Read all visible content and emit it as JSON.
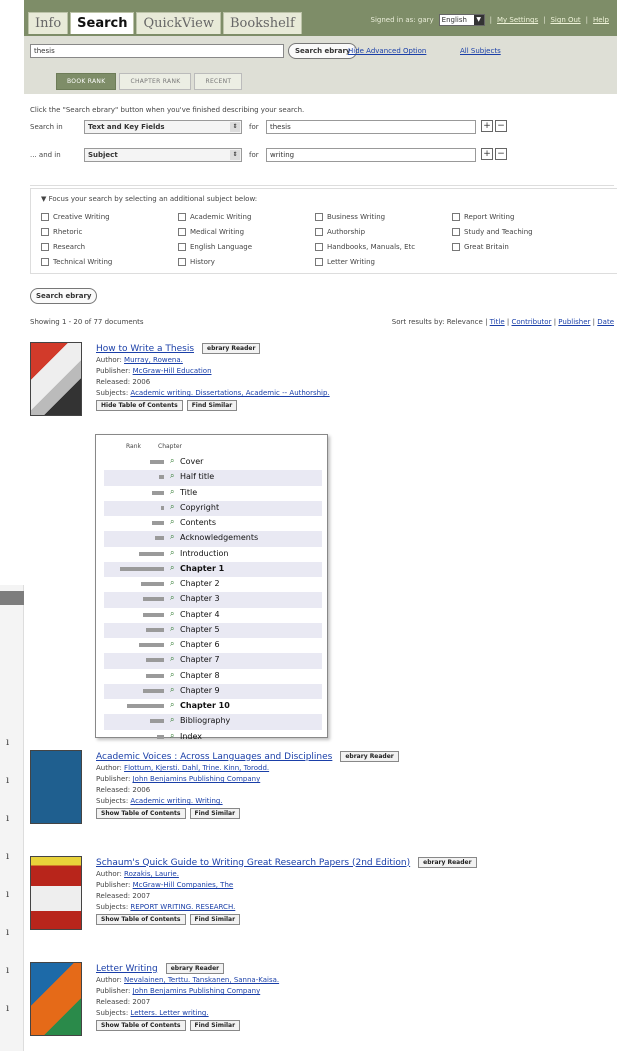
{
  "header": {
    "tabs": [
      "Info",
      "Search",
      "QuickView",
      "Bookshelf"
    ],
    "signed_in": "Signed in as: gary",
    "language": "English",
    "links": [
      "My Settings",
      "Sign Out",
      "Help"
    ],
    "colors": {
      "header_bg": "#7e8d68",
      "link": "#1a3fa8"
    }
  },
  "search": {
    "query": "thesis",
    "button": "Search ebrary",
    "hide_advanced": "Hide Advanced Option",
    "all_subjects": "All Subjects",
    "rank_tabs": [
      "BOOK RANK",
      "CHAPTER RANK",
      "RECENT"
    ]
  },
  "advanced": {
    "hint": "Click the \"Search ebrary\" button when you've finished describing your search.",
    "rows": [
      {
        "label": "Search in",
        "field": "Text and Key Fields",
        "for": "for",
        "value": "thesis"
      },
      {
        "label": "... and in",
        "field": "Subject",
        "for": "for",
        "value": "writing"
      }
    ],
    "focus_title": "Focus your search by selecting an additional subject below:",
    "subjects": [
      "Creative Writing",
      "Academic Writing",
      "Business Writing",
      "Report Writing",
      "Rhetoric",
      "Medical Writing",
      "Authorship",
      "Study and Teaching",
      "Research",
      "English Language",
      "Handbooks, Manuals, Etc",
      "Great Britain",
      "Technical Writing",
      "History",
      "Letter Writing"
    ],
    "search_button": "Search ebrary"
  },
  "results_info": {
    "showing": "Showing 1 - 20 of 77 documents",
    "sort_label": "Sort results by:",
    "sort_options": [
      "Relevance",
      "Title",
      "Contributor",
      "Publisher",
      "Date"
    ]
  },
  "results": [
    {
      "title": "How to Write a Thesis",
      "reader_btn": "ebrary Reader",
      "author_label": "Author:",
      "authors": "Murray, Rowena.",
      "publisher_label": "Publisher:",
      "publisher": "McGraw-Hill Education",
      "released": "Released: 2006",
      "subjects_label": "Subjects:",
      "subjects": "Academic writing.  Dissertations, Academic -- Authorship.",
      "toc_btn": "Hide Table of Contents",
      "similar_btn": "Find Similar"
    },
    {
      "title": "Academic Voices : Across Languages and Disciplines",
      "reader_btn": "ebrary Reader",
      "author_label": "Author:",
      "authors": "Flottum, Kjersti.  Dahl, Trine.  Kinn, Torodd.",
      "publisher_label": "Publisher:",
      "publisher": "John Benjamins Publishing Company",
      "released": "Released: 2006",
      "subjects_label": "Subjects:",
      "subjects": "Academic writing.  Writing.",
      "toc_btn": "Show Table of Contents",
      "similar_btn": "Find Similar"
    },
    {
      "title": "Schaum's Quick Guide to Writing Great Research Papers (2nd Edition)",
      "reader_btn": "ebrary Reader",
      "author_label": "Author:",
      "authors": "Rozakis, Laurie.",
      "publisher_label": "Publisher:",
      "publisher": "McGraw-Hill Companies, The",
      "released": "Released: 2007",
      "subjects_label": "Subjects:",
      "subjects": "REPORT WRITING.  RESEARCH.",
      "toc_btn": "Show Table of Contents",
      "similar_btn": "Find Similar"
    },
    {
      "title": "Letter Writing",
      "reader_btn": "ebrary Reader",
      "author_label": "Author:",
      "authors": "Nevalainen, Terttu.  Tanskanen, Sanna-Kaisa.",
      "publisher_label": "Publisher:",
      "publisher": "John Benjamins Publishing Company",
      "released": "Released: 2007",
      "subjects_label": "Subjects:",
      "subjects": "Letters.  Letter writing.",
      "toc_btn": "Show Table of Contents",
      "similar_btn": "Find Similar"
    }
  ],
  "toc": {
    "rank_header": "Rank",
    "chapter_header": "Chapter",
    "chapters": [
      {
        "name": "Cover",
        "rank": 0.3,
        "bold": false
      },
      {
        "name": "Half title",
        "rank": 0.1,
        "bold": false
      },
      {
        "name": "Title",
        "rank": 0.25,
        "bold": false
      },
      {
        "name": "Copyright",
        "rank": 0.05,
        "bold": false
      },
      {
        "name": "Contents",
        "rank": 0.25,
        "bold": false
      },
      {
        "name": "Acknowledgements",
        "rank": 0.2,
        "bold": false
      },
      {
        "name": "Introduction",
        "rank": 0.55,
        "bold": false
      },
      {
        "name": "Chapter 1",
        "rank": 0.95,
        "bold": true
      },
      {
        "name": "Chapter 2",
        "rank": 0.5,
        "bold": false
      },
      {
        "name": "Chapter 3",
        "rank": 0.45,
        "bold": false
      },
      {
        "name": "Chapter 4",
        "rank": 0.45,
        "bold": false
      },
      {
        "name": "Chapter 5",
        "rank": 0.4,
        "bold": false
      },
      {
        "name": "Chapter 6",
        "rank": 0.55,
        "bold": false
      },
      {
        "name": "Chapter 7",
        "rank": 0.4,
        "bold": false
      },
      {
        "name": "Chapter 8",
        "rank": 0.4,
        "bold": false
      },
      {
        "name": "Chapter 9",
        "rank": 0.45,
        "bold": false
      },
      {
        "name": "Chapter 10",
        "rank": 0.8,
        "bold": true
      },
      {
        "name": "Bibliography",
        "rank": 0.3,
        "bold": false
      },
      {
        "name": "Index",
        "rank": 0.15,
        "bold": false
      }
    ]
  }
}
